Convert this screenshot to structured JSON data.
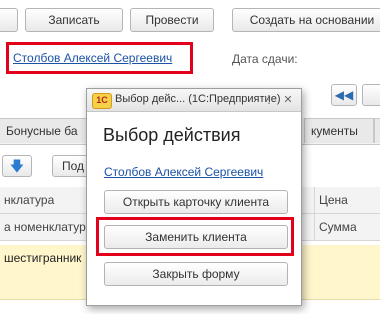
{
  "toolbar": {
    "record_label": "Записать",
    "post_label": "Провести",
    "create_basis_label": "Создать на основании"
  },
  "header": {
    "client_name": "Столбов Алексей Сергеевич",
    "date_label": "Дата сдачи:"
  },
  "tabs": {
    "bonus_label": "Бонусные ба",
    "documents_label": "кументы"
  },
  "table_toolbar": {
    "pick_label": "Под"
  },
  "table": {
    "col_nomenclature": "нклатура",
    "col_price": "Цена",
    "col_sub_nomenclature": "а номенклатур",
    "col_sum": "Сумма",
    "row1_text": "шестигранник"
  },
  "dialog": {
    "window_title": "Выбор дейс... (1С:Предприятие)",
    "heading": "Выбор действия",
    "client_link": "Столбов Алексей Сергеевич",
    "open_card_label": "Открыть карточку клиента",
    "replace_client_label": "Заменить клиента",
    "close_form_label": "Закрыть форму",
    "logo_text": "1С"
  },
  "colors": {
    "highlight_frame": "#e3001b",
    "link": "#1a52a6",
    "row_highlight": "#fff6cc"
  }
}
